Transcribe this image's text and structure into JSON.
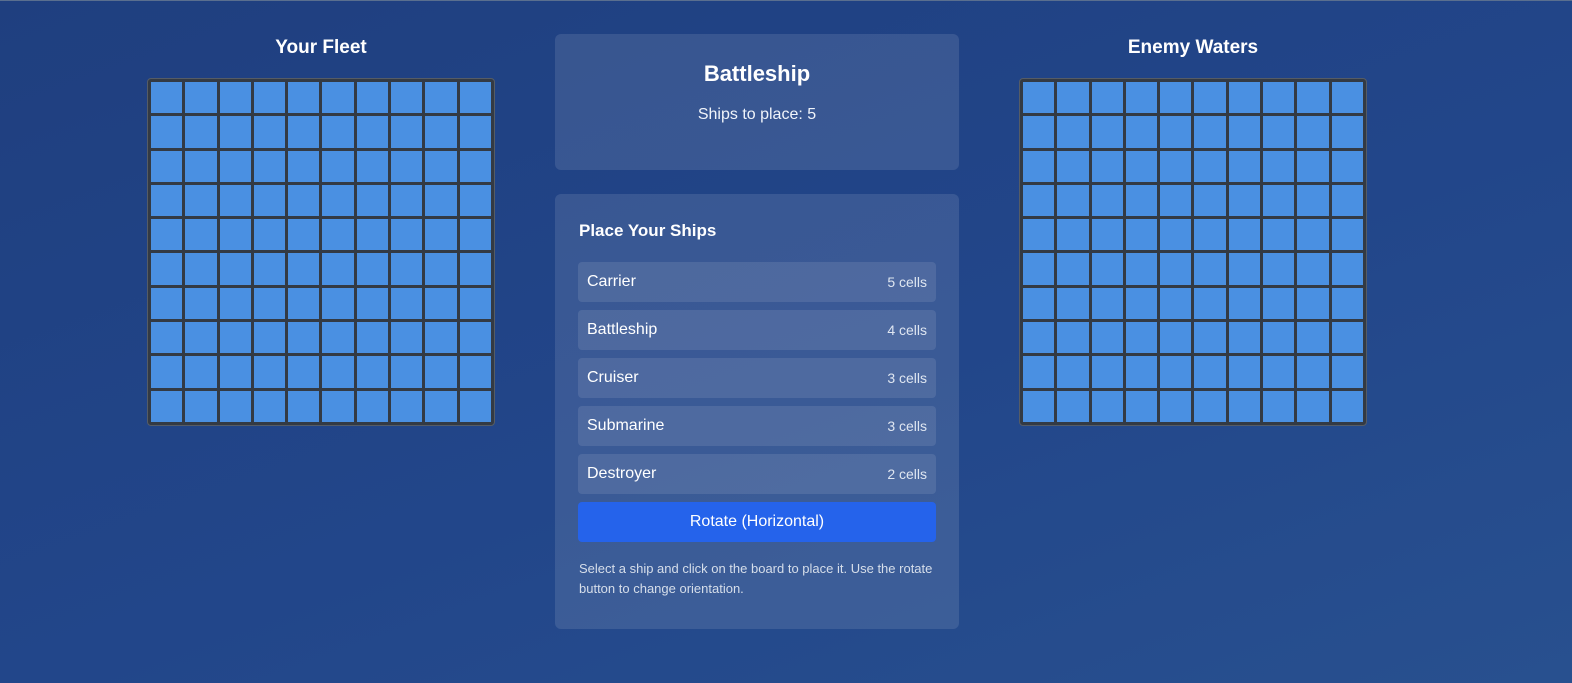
{
  "boards": {
    "player": {
      "title": "Your Fleet",
      "rows": 10,
      "cols": 10
    },
    "enemy": {
      "title": "Enemy Waters",
      "rows": 10,
      "cols": 10
    }
  },
  "status": {
    "title": "Battleship",
    "ships_to_place": "Ships to place: 5"
  },
  "placement": {
    "title": "Place Your Ships",
    "ships": [
      {
        "name": "Carrier",
        "size": "5 cells"
      },
      {
        "name": "Battleship",
        "size": "4 cells"
      },
      {
        "name": "Cruiser",
        "size": "3 cells"
      },
      {
        "name": "Submarine",
        "size": "3 cells"
      },
      {
        "name": "Destroyer",
        "size": "2 cells"
      }
    ],
    "rotate_label": "Rotate (Horizontal)",
    "help_text": "Select a ship and click on the board to place it. Use the rotate button to change orientation."
  },
  "colors": {
    "water_cell": "#4a90e2",
    "grid_lines": "#333a44",
    "button": "#2563eb"
  }
}
